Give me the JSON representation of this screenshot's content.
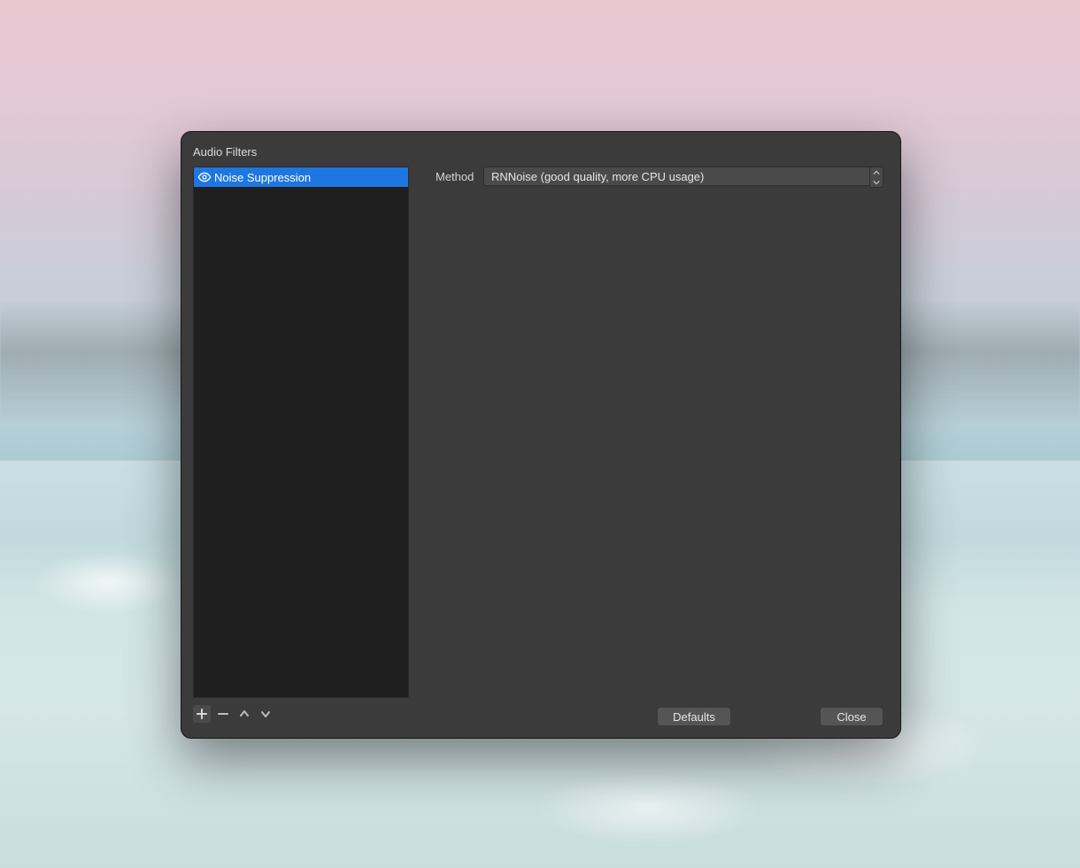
{
  "dialog": {
    "title": "Audio Filters"
  },
  "filters": {
    "items": [
      {
        "label": "Noise Suppression",
        "visible": true,
        "selected": true
      }
    ]
  },
  "properties": {
    "method_label": "Method",
    "method_value": "RNNoise (good quality, more CPU usage)"
  },
  "buttons": {
    "defaults": "Defaults",
    "close": "Close"
  },
  "icons": {
    "eye": "eye-icon",
    "plus": "plus-icon",
    "minus": "minus-icon",
    "up": "chevron-up-icon",
    "down": "chevron-down-icon",
    "stepper_up": "stepper-up-icon",
    "stepper_down": "stepper-down-icon"
  }
}
